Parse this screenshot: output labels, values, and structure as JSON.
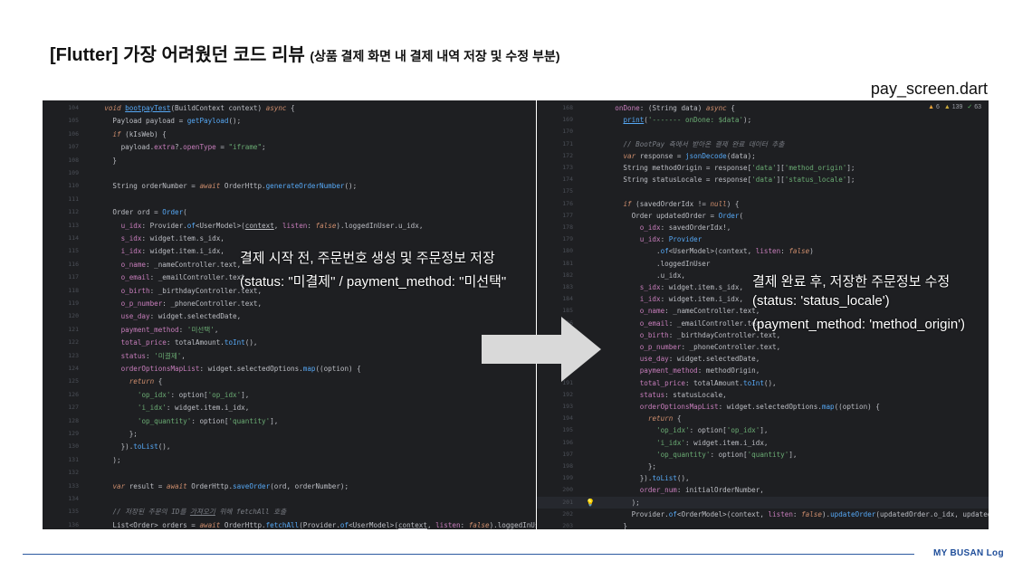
{
  "slide": {
    "title": "[Flutter] 가장 어려웠던 코드 리뷰",
    "subtitle": "(상품 결제 화면 내 결제 내역 저장 및 수정 부분)",
    "filename": "pay_screen.dart",
    "brand": "MY BUSAN Log"
  },
  "annotations": {
    "left_line1": "결제 시작 전, 주문번호 생성 및 주문정보 저장",
    "left_line2": "(status: \"미결제\" / payment_method: \"미선택\"",
    "right_line1": "결제 완료 후, 저장한 주문정보 수정",
    "right_line2": "(status: 'status_locale')",
    "right_line3": "(payment_method: 'method_origin')"
  },
  "right_status": {
    "warnings": "6",
    "weak_warnings": "139",
    "ok": "63"
  },
  "left_code": [
    {
      "n": "104",
      "html": "    <span class='kw'>void</span> <span class='fn'><u>bootpayTest</u></span>(BuildContext context) <span class='kw'>async</span> {"
    },
    {
      "n": "105",
      "html": "      Payload payload = <span class='fn'>getPayload</span>();"
    },
    {
      "n": "106",
      "html": "      <span class='kw'>if</span> (kIsWeb) {"
    },
    {
      "n": "107",
      "html": "        payload.<span class='prop'>extra</span>?.<span class='prop'>openType</span> = <span class='str'>\"iframe\"</span>;"
    },
    {
      "n": "108",
      "html": "      }"
    },
    {
      "n": "109",
      "html": ""
    },
    {
      "n": "110",
      "html": "      String orderNumber = <span class='kw'>await</span> OrderHttp.<span class='fn'>generateOrderNumber</span>();"
    },
    {
      "n": "111",
      "html": ""
    },
    {
      "n": "112",
      "html": "      Order ord = <span class='fn'>Order</span>("
    },
    {
      "n": "113",
      "html": "        <span class='prop'>u_idx</span>: Provider.<span class='fn'>of</span>&lt;UserModel&gt;(<u>context</u>, <span class='prop'>listen</span>: <span class='kw'>false</span>).loggedInUser.u_idx,"
    },
    {
      "n": "114",
      "html": "        <span class='prop'>s_idx</span>: widget.item.s_idx,"
    },
    {
      "n": "115",
      "html": "        <span class='prop'>i_idx</span>: widget.item.i_idx,"
    },
    {
      "n": "116",
      "html": "        <span class='prop'>o_name</span>: _nameController.text,"
    },
    {
      "n": "117",
      "html": "        <span class='prop'>o_email</span>: _emailController.text,"
    },
    {
      "n": "118",
      "html": "        <span class='prop'>o_birth</span>: _birthdayController.text,"
    },
    {
      "n": "119",
      "html": "        <span class='prop'>o_p_number</span>: _phoneController.text,"
    },
    {
      "n": "120",
      "html": "        <span class='prop'>use_day</span>: widget.selectedDate,"
    },
    {
      "n": "121",
      "html": "        <span class='prop'>payment_method</span>: <span class='str'>'미선택'</span>,"
    },
    {
      "n": "122",
      "html": "        <span class='prop'>total_price</span>: totalAmount.<span class='fn'>toInt</span>(),"
    },
    {
      "n": "123",
      "html": "        <span class='prop'>status</span>: <span class='str'>'미결제'</span>,"
    },
    {
      "n": "124",
      "html": "        <span class='prop'>orderOptionsMapList</span>: widget.selectedOptions.<span class='fn'>map</span>((option) {"
    },
    {
      "n": "125",
      "html": "          <span class='kw'>return</span> {"
    },
    {
      "n": "126",
      "html": "            <span class='str'>'op_idx'</span>: option[<span class='str'>'op_idx'</span>],"
    },
    {
      "n": "127",
      "html": "            <span class='str'>'i_idx'</span>: widget.item.i_idx,"
    },
    {
      "n": "128",
      "html": "            <span class='str'>'op_quantity'</span>: option[<span class='str'>'quantity'</span>],"
    },
    {
      "n": "129",
      "html": "          };"
    },
    {
      "n": "130",
      "html": "        }).<span class='fn'>toList</span>(),"
    },
    {
      "n": "131",
      "html": "      );"
    },
    {
      "n": "132",
      "html": ""
    },
    {
      "n": "133",
      "html": "      <span class='kw'>var</span> result = <span class='kw'>await</span> OrderHttp.<span class='fn'>saveOrder</span>(ord, orderNumber);"
    },
    {
      "n": "134",
      "html": ""
    },
    {
      "n": "135",
      "html": "      <span class='cm'>// 저장된 주문의 ID를 <u>가져오기</u> 위해 fetchAll 호출</span>"
    },
    {
      "n": "136",
      "html": "      List&lt;Order&gt; orders = <span class='kw'>await</span> OrderHttp.<span class='fn'>fetchAll</span>(Provider.<span class='fn'>of</span>&lt;UserModel&gt;(<u>context</u>, <span class='prop'>listen</span>: <span class='kw'>false</span>).loggedInUser.u_idx);"
    }
  ],
  "right_code": [
    {
      "n": "168",
      "html": "    <span class='prop'>onDone</span>: (String data) <span class='kw'>async</span> {"
    },
    {
      "n": "169",
      "html": "      <span class='fn'><u>print</u></span>(<span class='str'>'------- onDone: $data'</span>);"
    },
    {
      "n": "170",
      "html": ""
    },
    {
      "n": "171",
      "html": "      <span class='cm'>// BootPay 측에서 받아온 결제 완료 데이터 추출</span>"
    },
    {
      "n": "172",
      "html": "      <span class='kw'>var</span> response = <span class='fn'>jsonDecode</span>(data);"
    },
    {
      "n": "173",
      "html": "      String methodOrigin = response[<span class='str'>'data'</span>][<span class='str'>'method_origin'</span>];"
    },
    {
      "n": "174",
      "html": "      String statusLocale = response[<span class='str'>'data'</span>][<span class='str'>'status_locale'</span>];"
    },
    {
      "n": "175",
      "html": ""
    },
    {
      "n": "176",
      "html": "      <span class='kw'>if</span> (savedOrderIdx != <span class='kw'>null</span>) {"
    },
    {
      "n": "177",
      "html": "        Order updatedOrder = <span class='fn'>Order</span>("
    },
    {
      "n": "178",
      "html": "          <span class='prop'>o_idx</span>: savedOrderIdx!,"
    },
    {
      "n": "179",
      "html": "          <span class='prop'>u_idx</span>: <span class='fn'>Provider</span>"
    },
    {
      "n": "180",
      "html": "              .<span class='fn'>of</span>&lt;UserModel&gt;(context, <span class='prop'>listen</span>: <span class='kw'>false</span>)"
    },
    {
      "n": "181",
      "html": "              .loggedInUser"
    },
    {
      "n": "182",
      "html": "              .u_idx,"
    },
    {
      "n": "183",
      "html": "          <span class='prop'>s_idx</span>: widget.item.s_idx,"
    },
    {
      "n": "184",
      "html": "          <span class='prop'>i_idx</span>: widget.item.i_idx,"
    },
    {
      "n": "185",
      "html": "          <span class='prop'>o_name</span>: _nameController.text,"
    },
    {
      "n": "186",
      "html": "          <span class='prop'>o_email</span>: _emailController.text,"
    },
    {
      "n": "187",
      "html": "          <span class='prop'>o_birth</span>: _birthdayController.text,"
    },
    {
      "n": "188",
      "html": "          <span class='prop'>o_p_number</span>: _phoneController.text,"
    },
    {
      "n": "189",
      "html": "          <span class='prop'>use_day</span>: widget.selectedDate,"
    },
    {
      "n": "190",
      "html": "          <span class='prop'>payment_method</span>: methodOrigin,"
    },
    {
      "n": "191",
      "html": "          <span class='prop'>total_price</span>: totalAmount.<span class='fn'>toInt</span>(),"
    },
    {
      "n": "192",
      "html": "          <span class='prop'>status</span>: statusLocale,"
    },
    {
      "n": "193",
      "html": "          <span class='prop'>orderOptionsMapList</span>: widget.selectedOptions.<span class='fn'>map</span>((option) {"
    },
    {
      "n": "194",
      "html": "            <span class='kw'>return</span> {"
    },
    {
      "n": "195",
      "html": "              <span class='str'>'op_idx'</span>: option[<span class='str'>'op_idx'</span>],"
    },
    {
      "n": "196",
      "html": "              <span class='str'>'i_idx'</span>: widget.item.i_idx,"
    },
    {
      "n": "197",
      "html": "              <span class='str'>'op_quantity'</span>: option[<span class='str'>'quantity'</span>],"
    },
    {
      "n": "198",
      "html": "            };"
    },
    {
      "n": "199",
      "html": "          }).<span class='fn'>toList</span>(),"
    },
    {
      "n": "200",
      "html": "          <span class='prop'>order_num</span>: initialOrderNumber,"
    },
    {
      "n": "201",
      "html": "        );"
    },
    {
      "n": "202",
      "html": "        Provider.<span class='fn'>of</span>&lt;OrderModel&gt;(context, <span class='prop'>listen</span>: <span class='kw'>false</span>).<span class='fn'>updateOrder</span>(updatedOrder.o_idx, updatedOrder);"
    },
    {
      "n": "203",
      "html": "      }"
    }
  ]
}
